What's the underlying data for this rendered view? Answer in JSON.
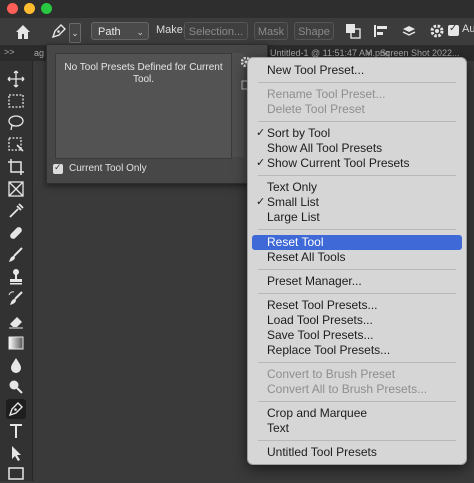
{
  "options_bar": {
    "mode_value": "Path",
    "make_label": "Make:",
    "selection_label": "Selection...",
    "mask_label": "Mask",
    "shape_label": "Shape",
    "auto_add_label": "Au"
  },
  "tab_strip": {
    "overflow": ">>",
    "tab1": "ag",
    "tab1_close": "×",
    "tab2": "Untitled-1 @ 11:51:47 AM.png",
    "tab2_close": "×",
    "tab3": "Screen Shot 2022..."
  },
  "preset_picker": {
    "empty_message_line1": "No Tool Presets Defined for Current",
    "empty_message_line2": "Tool.",
    "current_tool_only_label": "Current Tool Only",
    "current_tool_only_checked": true
  },
  "menu": {
    "items": [
      {
        "label": "New Tool Preset...",
        "enabled": true
      },
      {
        "label": "Rename Tool Preset...",
        "enabled": false
      },
      {
        "label": "Delete Tool Preset",
        "enabled": false
      },
      {
        "label": "Sort by Tool",
        "enabled": true,
        "checked": true
      },
      {
        "label": "Show All Tool Presets",
        "enabled": true
      },
      {
        "label": "Show Current Tool Presets",
        "enabled": true,
        "checked": true
      },
      {
        "label": "Text Only",
        "enabled": true
      },
      {
        "label": "Small List",
        "enabled": true,
        "checked": true
      },
      {
        "label": "Large List",
        "enabled": true
      },
      {
        "label": "Reset Tool",
        "enabled": true,
        "highlighted": true
      },
      {
        "label": "Reset All Tools",
        "enabled": true
      },
      {
        "label": "Preset Manager...",
        "enabled": true
      },
      {
        "label": "Reset Tool Presets...",
        "enabled": true
      },
      {
        "label": "Load Tool Presets...",
        "enabled": true
      },
      {
        "label": "Save Tool Presets...",
        "enabled": true
      },
      {
        "label": "Replace Tool Presets...",
        "enabled": true
      },
      {
        "label": "Convert to Brush Preset",
        "enabled": false
      },
      {
        "label": "Convert All to Brush Presets...",
        "enabled": false
      },
      {
        "label": "Crop and Marquee",
        "enabled": true
      },
      {
        "label": "Text",
        "enabled": true
      },
      {
        "label": "Untitled Tool Presets",
        "enabled": true
      }
    ],
    "check_glyph": "✓"
  },
  "colors": {
    "highlight": "#3f69d6",
    "close_light": "#ff5f57",
    "minimize_light": "#febc2e",
    "zoom_light": "#28c840"
  }
}
